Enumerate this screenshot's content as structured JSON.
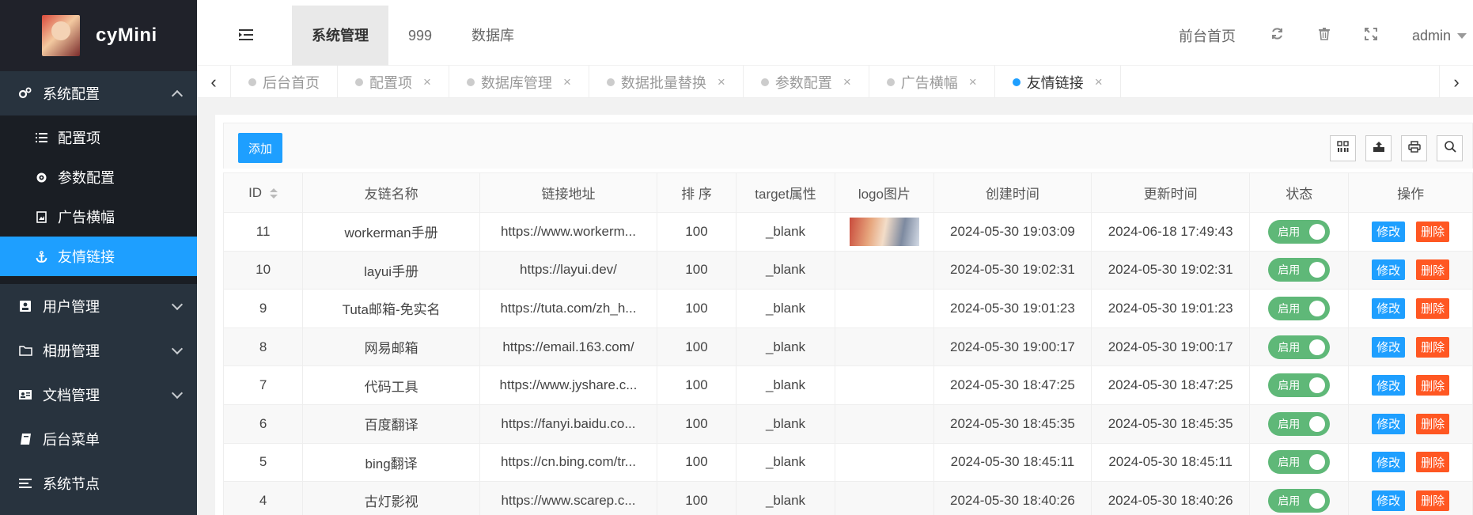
{
  "app": {
    "name": "cyMini"
  },
  "sidebar": {
    "groups": [
      {
        "label": "系统配置",
        "icon": "gears-icon",
        "expanded": true
      },
      {
        "label": "用户管理",
        "icon": "user-card-icon",
        "expanded": false
      },
      {
        "label": "相册管理",
        "icon": "folder-icon",
        "expanded": false
      },
      {
        "label": "文档管理",
        "icon": "id-card-icon",
        "expanded": false
      },
      {
        "label": "后台菜单",
        "icon": "book-icon"
      },
      {
        "label": "系统节点",
        "icon": "list-icon"
      }
    ],
    "sub_items": [
      {
        "label": "配置项",
        "icon": "list-ol-icon"
      },
      {
        "label": "参数配置",
        "icon": "gear-icon"
      },
      {
        "label": "广告横幅",
        "icon": "image-file-icon"
      },
      {
        "label": "友情链接",
        "icon": "anchor-icon",
        "active": true
      }
    ]
  },
  "header": {
    "nav": [
      "系统管理",
      "999",
      "数据库"
    ],
    "right": {
      "home": "前台首页",
      "user": "admin"
    }
  },
  "tabs": [
    {
      "label": "后台首页",
      "closable": false
    },
    {
      "label": "配置项",
      "closable": true
    },
    {
      "label": "数据库管理",
      "closable": true
    },
    {
      "label": "数据批量替换",
      "closable": true
    },
    {
      "label": "参数配置",
      "closable": true
    },
    {
      "label": "广告横幅",
      "closable": true
    },
    {
      "label": "友情链接",
      "closable": true,
      "active": true
    }
  ],
  "toolbar": {
    "add_label": "添加"
  },
  "table": {
    "columns": [
      "ID",
      "友链名称",
      "链接地址",
      "排 序",
      "target属性",
      "logo图片",
      "创建时间",
      "更新时间",
      "状态",
      "操作"
    ],
    "rows": [
      {
        "id": "11",
        "name": "workerman手册",
        "url": "https://www.workerm...",
        "sort": "100",
        "target": "_blank",
        "logo": true,
        "created": "2024-05-30 19:03:09",
        "updated": "2024-06-18 17:49:43"
      },
      {
        "id": "10",
        "name": "layui手册",
        "url": "https://layui.dev/",
        "sort": "100",
        "target": "_blank",
        "logo": false,
        "created": "2024-05-30 19:02:31",
        "updated": "2024-05-30 19:02:31"
      },
      {
        "id": "9",
        "name": "Tuta邮箱-免实名",
        "url": "https://tuta.com/zh_h...",
        "sort": "100",
        "target": "_blank",
        "logo": false,
        "created": "2024-05-30 19:01:23",
        "updated": "2024-05-30 19:01:23"
      },
      {
        "id": "8",
        "name": "网易邮箱",
        "url": "https://email.163.com/",
        "sort": "100",
        "target": "_blank",
        "logo": false,
        "created": "2024-05-30 19:00:17",
        "updated": "2024-05-30 19:00:17"
      },
      {
        "id": "7",
        "name": "代码工具",
        "url": "https://www.jyshare.c...",
        "sort": "100",
        "target": "_blank",
        "logo": false,
        "created": "2024-05-30 18:47:25",
        "updated": "2024-05-30 18:47:25"
      },
      {
        "id": "6",
        "name": "百度翻译",
        "url": "https://fanyi.baidu.co...",
        "sort": "100",
        "target": "_blank",
        "logo": false,
        "created": "2024-05-30 18:45:35",
        "updated": "2024-05-30 18:45:35"
      },
      {
        "id": "5",
        "name": "bing翻译",
        "url": "https://cn.bing.com/tr...",
        "sort": "100",
        "target": "_blank",
        "logo": false,
        "created": "2024-05-30 18:45:11",
        "updated": "2024-05-30 18:45:11"
      },
      {
        "id": "4",
        "name": "古灯影视",
        "url": "https://www.scarep.c...",
        "sort": "100",
        "target": "_blank",
        "logo": false,
        "created": "2024-05-30 18:40:26",
        "updated": "2024-05-30 18:40:26"
      }
    ],
    "status_label": "启用",
    "edit_label": "修改",
    "delete_label": "删除"
  },
  "colors": {
    "primary": "#1e9fff",
    "success": "#5fb878",
    "danger": "#ff5722",
    "sidebar": "#28333e"
  }
}
